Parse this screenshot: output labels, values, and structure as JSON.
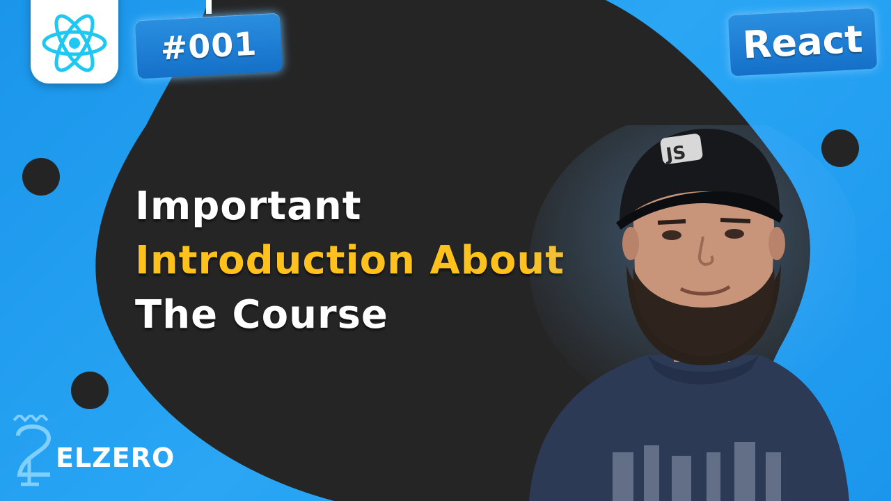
{
  "episode": {
    "number": "#001"
  },
  "topic": {
    "label": "React"
  },
  "title": {
    "line1": "Important",
    "line2": "Introduction About",
    "line3": "The Course"
  },
  "brand": {
    "name": "ELZERO"
  },
  "colors": {
    "background_blue": "#1e9cf0",
    "blob_dark": "#252525",
    "accent_yellow": "#ffc21c",
    "react_cyan": "#1ec8f0",
    "text_white": "#ffffff"
  },
  "icons": [
    "react-logo-icon",
    "elzero-logo-icon",
    "js-cap-icon"
  ]
}
